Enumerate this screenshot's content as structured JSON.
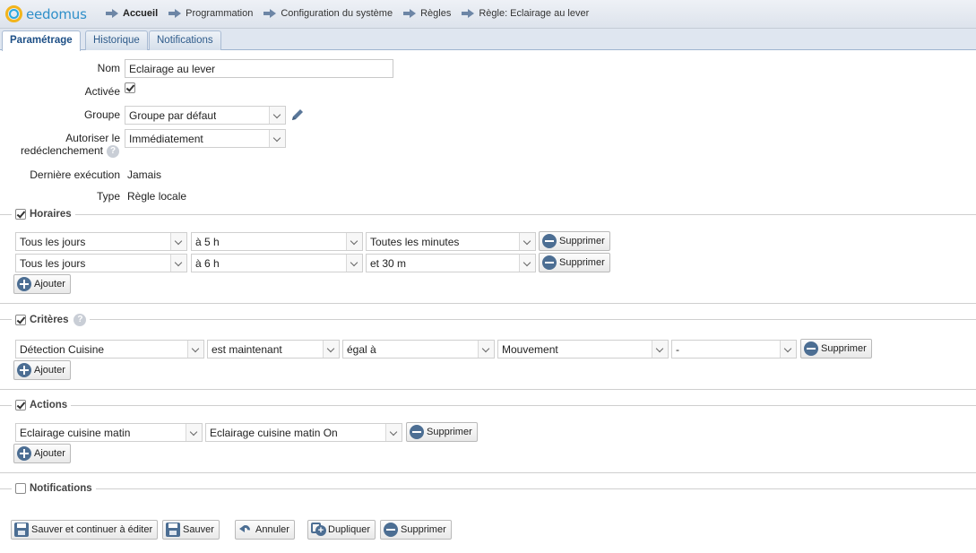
{
  "app": {
    "logo_text": "eedomus"
  },
  "breadcrumb": [
    "Accueil",
    "Programmation",
    "Configuration du système",
    "Règles",
    "Règle: Eclairage au lever"
  ],
  "tabs": [
    "Paramétrage",
    "Historique",
    "Notifications"
  ],
  "form": {
    "nom_label": "Nom",
    "nom_value": "Eclairage au lever",
    "activee_label": "Activée",
    "activee_checked": true,
    "groupe_label": "Groupe",
    "groupe_value": "Groupe par défaut",
    "autoriser_label_1": "Autoriser le",
    "autoriser_label_2": "redéclenchement",
    "autoriser_value": "Immédiatement",
    "derniere_label": "Dernière exécution",
    "derniere_value": "Jamais",
    "type_label": "Type",
    "type_value": "Règle locale",
    "help_glyph": "?"
  },
  "horaires": {
    "title": "Horaires",
    "checked": true,
    "rows": [
      {
        "day": "Tous les jours",
        "hour": "à 5 h",
        "minute": "Toutes les minutes"
      },
      {
        "day": "Tous les jours",
        "hour": "à 6 h",
        "minute": "et 30 m"
      }
    ],
    "add_label": "Ajouter",
    "remove_label": "Supprimer"
  },
  "criteres": {
    "title": "Critères",
    "checked": true,
    "row": {
      "device": "Détection Cuisine",
      "when": "est maintenant",
      "operator": "égal à",
      "value": "Mouvement",
      "extra": "-"
    },
    "add_label": "Ajouter",
    "remove_label": "Supprimer"
  },
  "actions": {
    "title": "Actions",
    "checked": true,
    "row": {
      "device": "Eclairage cuisine matin",
      "value": "Eclairage cuisine matin On"
    },
    "add_label": "Ajouter",
    "remove_label": "Supprimer"
  },
  "notifications": {
    "title": "Notifications",
    "checked": false
  },
  "footer": {
    "save_continue": "Sauver et continuer à éditer",
    "save": "Sauver",
    "cancel": "Annuler",
    "duplicate": "Dupliquer",
    "delete": "Supprimer"
  }
}
